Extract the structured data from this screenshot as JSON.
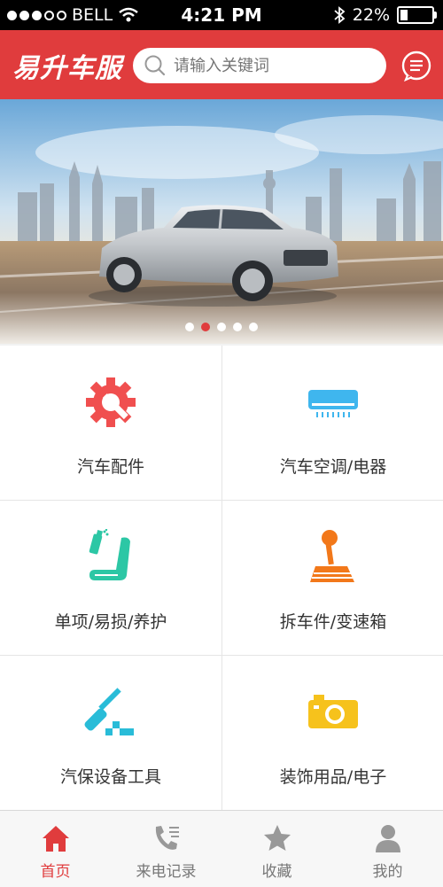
{
  "status_bar": {
    "carrier": "BELL",
    "time": "4:21 PM",
    "battery": "22%"
  },
  "header": {
    "brand": "易升车服",
    "search_placeholder": "请输入关键词"
  },
  "banner": {
    "page_count": 5,
    "active_index": 1
  },
  "categories": [
    {
      "label": "汽车配件",
      "icon": "wrench-gear-icon",
      "color": "#f04f4f"
    },
    {
      "label": "汽车空调/电器",
      "icon": "air-conditioner-icon",
      "color": "#3fb6ee"
    },
    {
      "label": "单项/易损/养护",
      "icon": "spray-seat-icon",
      "color": "#2cc7a5"
    },
    {
      "label": "拆车件/变速箱",
      "icon": "gear-shifter-icon",
      "color": "#f2781a"
    },
    {
      "label": "汽保设备工具",
      "icon": "screwdriver-tools-icon",
      "color": "#29bcd8"
    },
    {
      "label": "装饰用品/电子",
      "icon": "camera-icon",
      "color": "#f6c21c"
    }
  ],
  "tabs": [
    {
      "label": "首页",
      "icon": "home-icon",
      "active": true
    },
    {
      "label": "来电记录",
      "icon": "call-log-icon",
      "active": false
    },
    {
      "label": "收藏",
      "icon": "star-icon",
      "active": false
    },
    {
      "label": "我的",
      "icon": "person-icon",
      "active": false
    }
  ],
  "colors": {
    "brand_red": "#e03c3d"
  }
}
